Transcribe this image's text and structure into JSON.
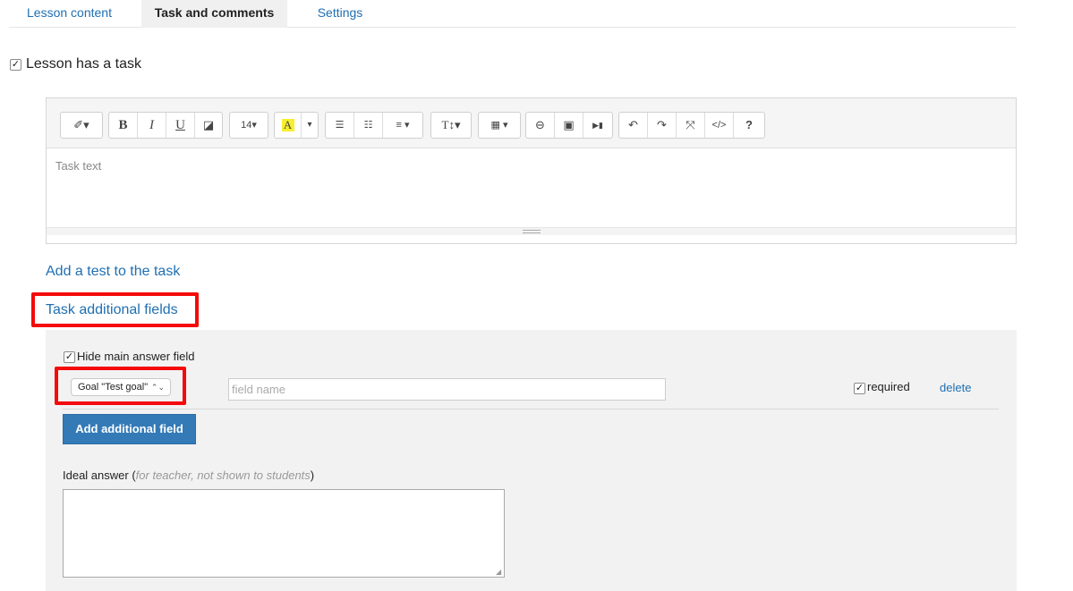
{
  "tabs": [
    {
      "label": "Lesson content"
    },
    {
      "label": "Task and comments"
    },
    {
      "label": "Settings"
    }
  ],
  "lesson_has_task": {
    "checked": true,
    "label": "Lesson has a task"
  },
  "toolbar": {
    "magic": "✐▾",
    "bold": "B",
    "italic": "I",
    "underline": "U",
    "eraser": "◪",
    "font_size": "14▾",
    "highlight": "A",
    "highlight_dropdown": "▾",
    "ul": "☰",
    "ol": "☷",
    "align": "≡ ▾",
    "text_style": "T↕▾",
    "table": "▦ ▾",
    "link": "⊖",
    "image": "▣",
    "video": "▶▮",
    "undo": "↶",
    "redo": "↷",
    "fullscreen": "⤧",
    "code": "</>",
    "help": "?"
  },
  "editor": {
    "placeholder": "Task text"
  },
  "add_test_link": "Add a test to the task",
  "additional_fields_link": "Task additional fields",
  "hide_main": {
    "checked": true,
    "label": "Hide main answer field"
  },
  "field_row": {
    "select_value": "Goal \"Test goal\"",
    "select_arrows": "⌃⌄",
    "name_placeholder": "field name",
    "required_checked": true,
    "required_label": "required",
    "delete_label": "delete"
  },
  "add_field_button": "Add additional field",
  "ideal_answer": {
    "label": "Ideal answer",
    "open_paren": " (",
    "hint": "for teacher, not shown to students",
    "close_paren": ")"
  },
  "colors": {
    "link": "#1f6fb2",
    "primary_button": "#337ab7",
    "highlight_box": "#f40a0a",
    "panel": "#f2f2f2"
  }
}
